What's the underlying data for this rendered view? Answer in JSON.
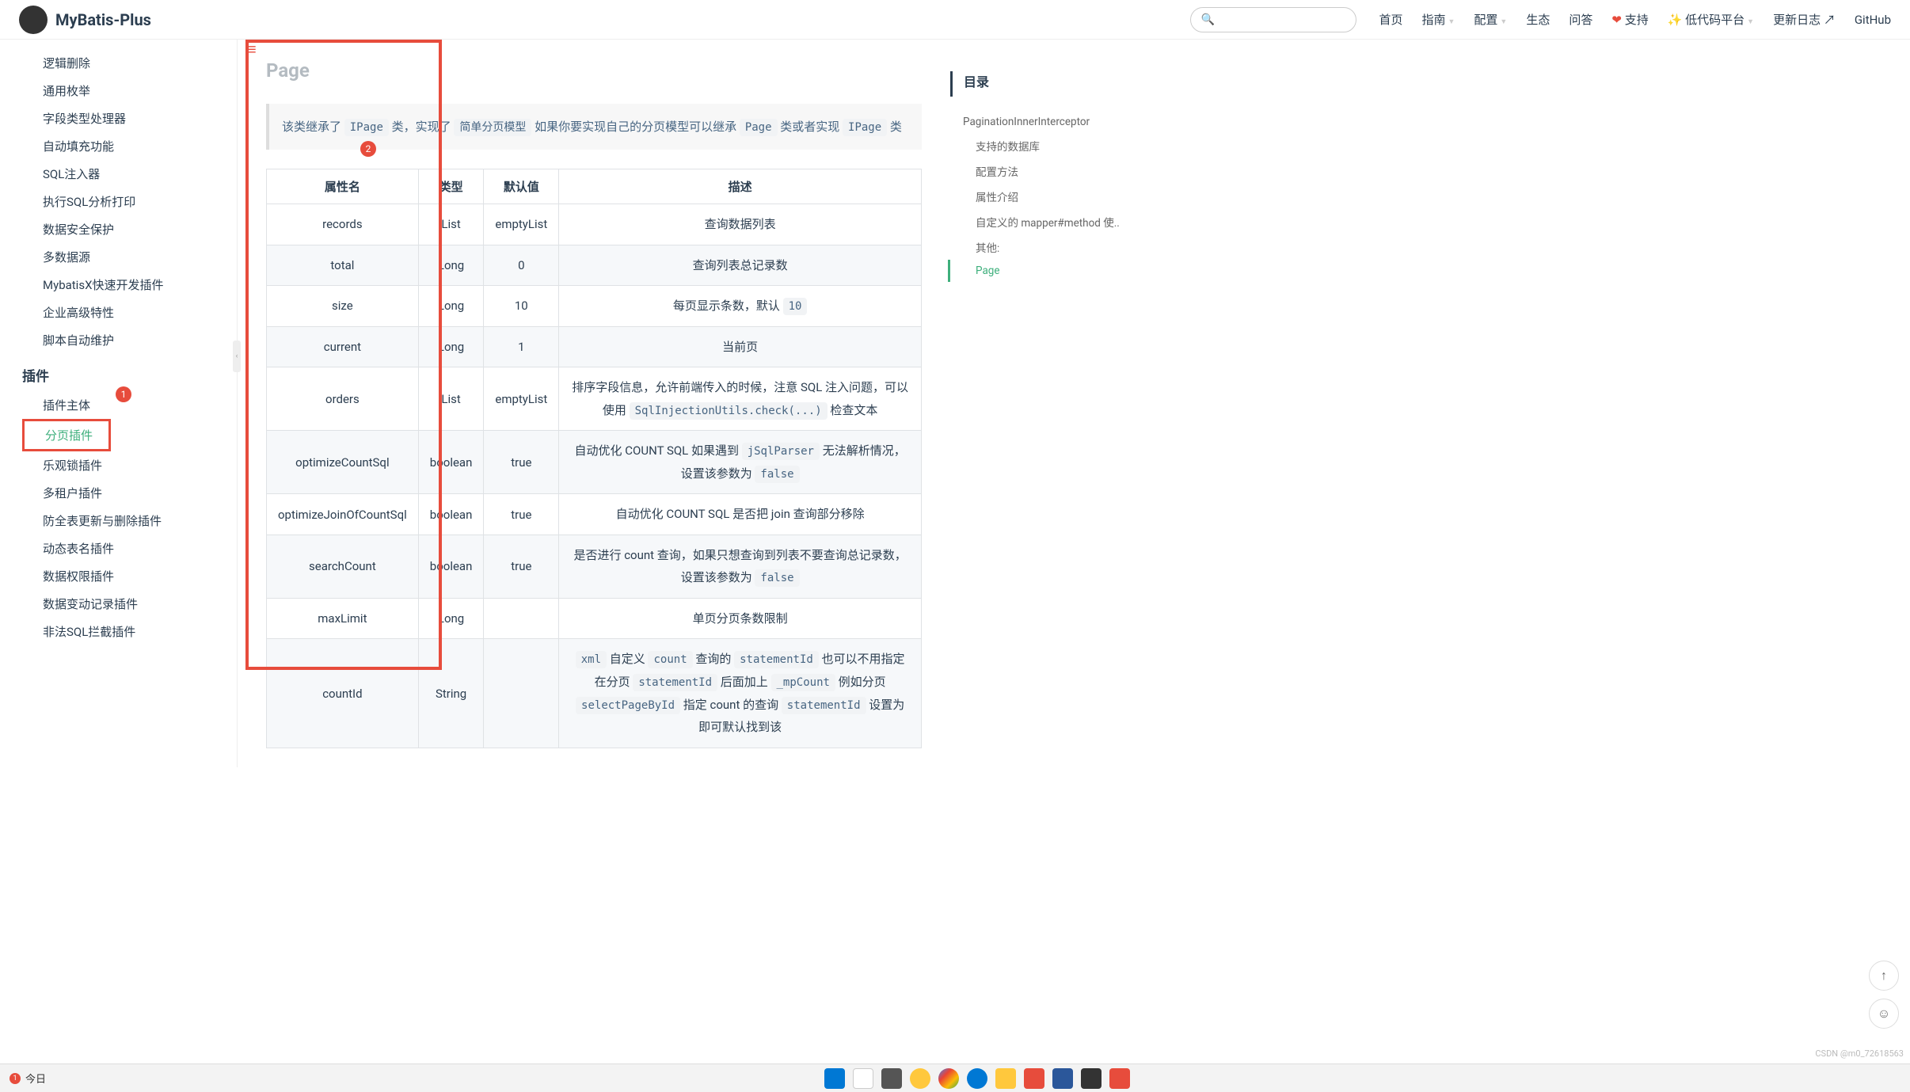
{
  "header": {
    "logo": "MyBatis-Plus",
    "nav": [
      "首页",
      "指南",
      "配置",
      "生态",
      "问答",
      "支持",
      "低代码平台",
      "更新日志",
      "GitHub"
    ]
  },
  "sidebar": {
    "items1": [
      "逻辑删除",
      "通用枚举",
      "字段类型处理器",
      "自动填充功能",
      "SQL注入器",
      "执行SQL分析打印",
      "数据安全保护",
      "多数据源",
      "MybatisX快速开发插件",
      "企业高级特性",
      "脚本自动维护"
    ],
    "heading": "插件",
    "items2": [
      "插件主体",
      "分页插件",
      "乐观锁插件",
      "多租户插件",
      "防全表更新与删除插件",
      "动态表名插件",
      "数据权限插件",
      "数据变动记录插件",
      "非法SQL拦截插件"
    ]
  },
  "main": {
    "titleCut": "Page",
    "desc": {
      "t1": "该类继承了 ",
      "c1": "IPage",
      "t2": " 类，实现了 ",
      "c2": "简单分页模型",
      "t3": " 如果你要实现自己的分页模型可以继承 ",
      "c3": "Page",
      "t4": " 类或者实现 ",
      "c4": "IPage",
      "t5": " 类"
    },
    "table": {
      "headers": [
        "属性名",
        "类型",
        "默认值",
        "描述"
      ],
      "rows": [
        {
          "name": "records",
          "type": "List",
          "default": "emptyList",
          "desc": "查询数据列表"
        },
        {
          "name": "total",
          "type": "Long",
          "default": "0",
          "desc": "查询列表总记录数"
        },
        {
          "name": "size",
          "type": "Long",
          "default": "10",
          "desc_pre": "每页显示条数，默认 ",
          "code": "10"
        },
        {
          "name": "current",
          "type": "Long",
          "default": "1",
          "desc": "当前页"
        },
        {
          "name": "orders",
          "type": "List",
          "default": "emptyList",
          "desc_pre": "排序字段信息，允许前端传入的时候，注意 SQL 注入问题，可以使用 ",
          "code": "SqlInjectionUtils.check(...)",
          "desc_post": " 检查文本"
        },
        {
          "name": "optimizeCountSql",
          "type": "boolean",
          "default": "true",
          "desc_pre": "自动优化 COUNT SQL 如果遇到 ",
          "code": "jSqlParser",
          "desc_mid": " 无法解析情况，设置该参数为 ",
          "code2": "false"
        },
        {
          "name": "optimizeJoinOfCountSql",
          "type": "boolean",
          "default": "true",
          "desc": "自动优化 COUNT SQL 是否把 join 查询部分移除"
        },
        {
          "name": "searchCount",
          "type": "boolean",
          "default": "true",
          "desc_pre": "是否进行 count 查询，如果只想查询到列表不要查询总记录数，设置该参数为 ",
          "code": "false"
        },
        {
          "name": "maxLimit",
          "type": "Long",
          "default": "",
          "desc": "单页分页条数限制"
        },
        {
          "name": "countId",
          "type": "String",
          "default": "",
          "codes": [
            "xml",
            "count",
            "statementId",
            "statementId",
            "_mpCount",
            "selectPageById",
            "statementId"
          ],
          "text_parts": [
            " 自定义 ",
            " 查询的 ",
            " 也可以不用指定在分页 ",
            " 后面加上 ",
            " 例如分页 ",
            " 指定 count 的查询 ",
            " 设置为 即可默认找到该 "
          ]
        }
      ]
    }
  },
  "toc": {
    "title": "目录",
    "items": [
      {
        "label": "PaginationInnerInterceptor",
        "level": 1
      },
      {
        "label": "支持的数据库",
        "level": 2
      },
      {
        "label": "配置方法",
        "level": 2
      },
      {
        "label": "属性介绍",
        "level": 2
      },
      {
        "label": "自定义的 mapper#method 使..",
        "level": 2
      },
      {
        "label": "其他:",
        "level": 2
      },
      {
        "label": "Page",
        "level": 2,
        "active": true
      }
    ]
  },
  "watermark": "CSDN @m0_72618563",
  "taskbar": {
    "left": "今日"
  }
}
